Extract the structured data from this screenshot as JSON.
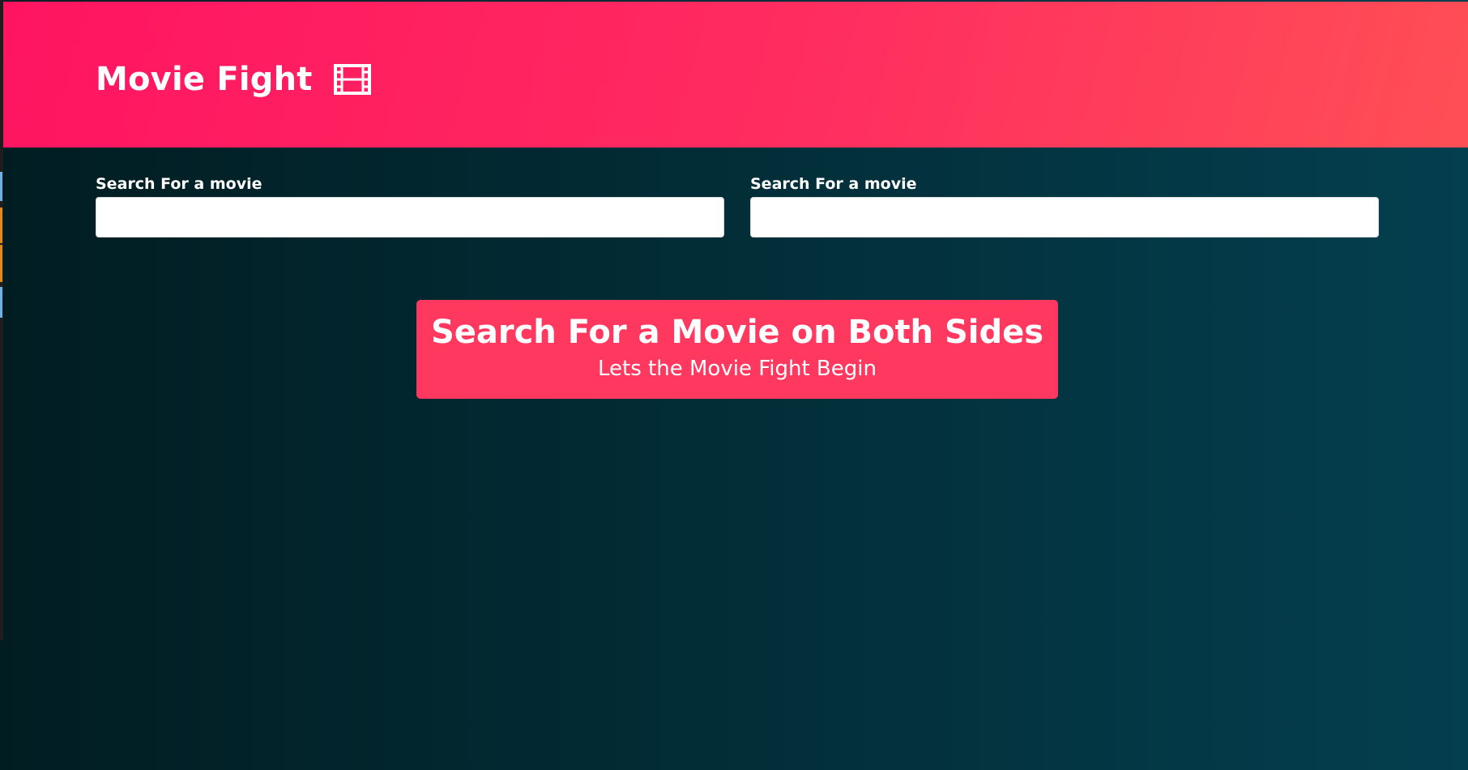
{
  "header": {
    "title": "Movie Fight",
    "icon": "film-icon"
  },
  "search": {
    "left": {
      "label": "Search For a movie",
      "value": "",
      "placeholder": ""
    },
    "right": {
      "label": "Search For a movie",
      "value": "",
      "placeholder": ""
    }
  },
  "notification": {
    "title": "Search For a Movie on Both Sides",
    "subtitle": "Lets the Movie Fight Begin"
  },
  "colors": {
    "hero_gradient_start": "#ff1461",
    "hero_gradient_end": "#ff4f55",
    "background_dark": "#011d22",
    "background_teal": "#043f4f",
    "message_box": "#ff3860",
    "input_bg": "#ffffff"
  }
}
